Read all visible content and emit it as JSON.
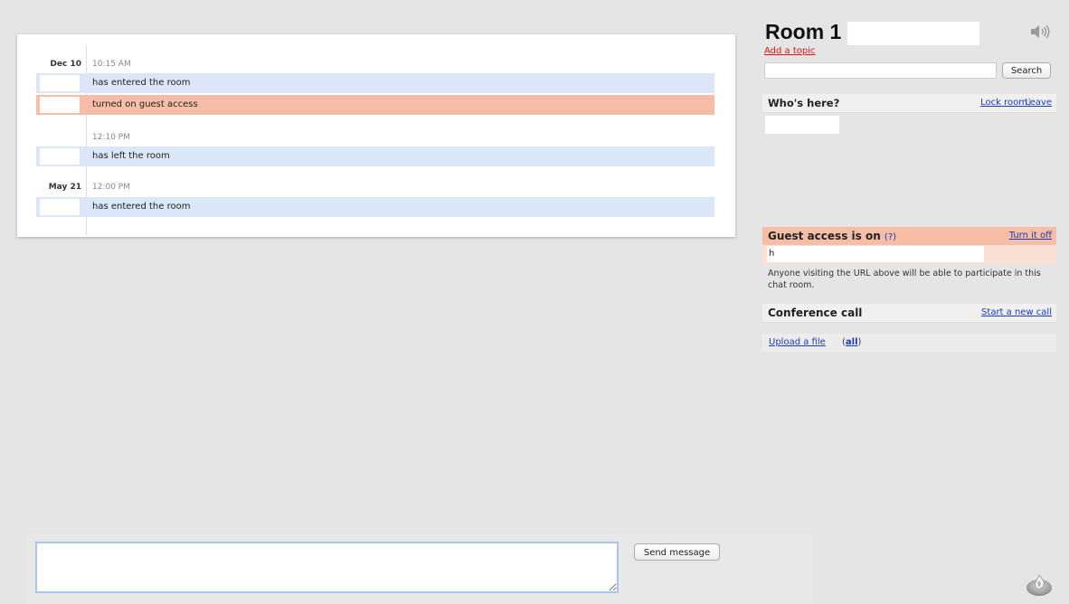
{
  "chat": {
    "entries": [
      {
        "date": "Dec 10",
        "time": "10:15 AM"
      },
      {
        "message": "has entered the room",
        "kind": "enter"
      },
      {
        "message": "turned on guest access",
        "kind": "guest"
      },
      {
        "time": "12:10 PM"
      },
      {
        "message": "has left the room",
        "kind": "leave"
      },
      {
        "date": "May 21",
        "time": "12:00 PM"
      },
      {
        "message": "has entered the room",
        "kind": "enter"
      }
    ]
  },
  "composer": {
    "send_label": "Send message",
    "message_value": ""
  },
  "sidebar": {
    "room_title": "Room 1",
    "add_topic": "Add a topic",
    "search_label": "Search",
    "whos_here_title": "Who's here?",
    "lock_room": "Lock room",
    "separator": "|",
    "leave": "Leave",
    "guest_access_title": "Guest access is on",
    "guest_help": "(?)",
    "turn_off": "Turn it off",
    "guest_url": "h",
    "guest_note": "Anyone visiting the URL above will be able to participate in this chat room.",
    "conference_title": "Conference call",
    "start_call": "Start a new call",
    "upload_file": "Upload a file",
    "all_open": "(",
    "all_link": "all",
    "all_close": ")"
  },
  "colors": {
    "background": "#e5e5e5",
    "enter_row": "#dce6f9",
    "guest_row": "#f6bea6",
    "link": "#1a3bb8",
    "add_topic": "#dd1111"
  },
  "icons": {
    "sound": "speaker-icon",
    "logo": "campfire-logo-icon"
  }
}
